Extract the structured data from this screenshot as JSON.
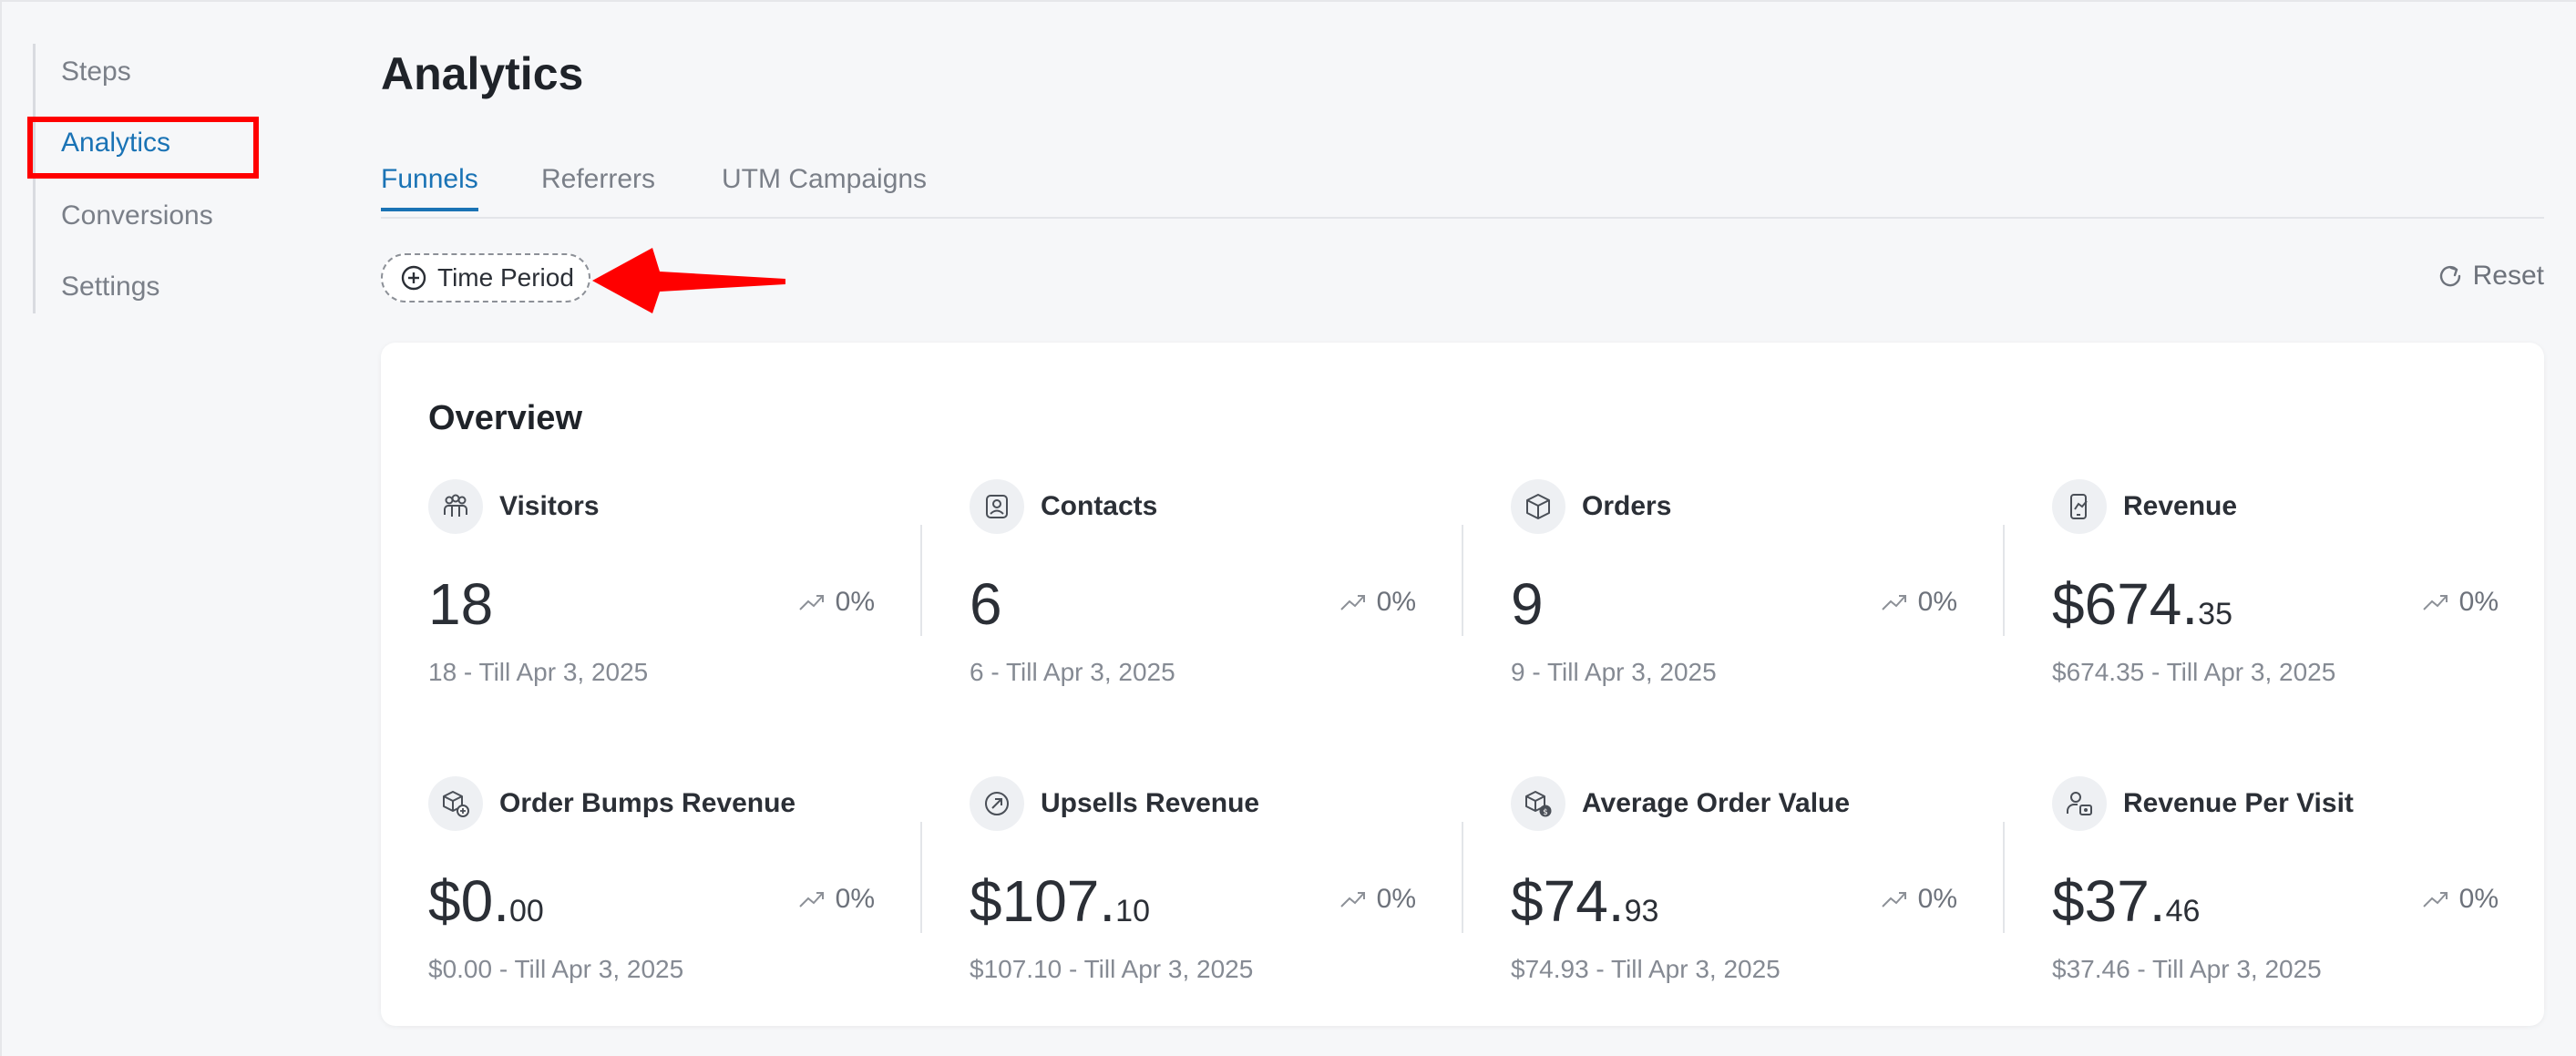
{
  "sidebar": {
    "items": [
      {
        "label": "Steps"
      },
      {
        "label": "Analytics"
      },
      {
        "label": "Conversions"
      },
      {
        "label": "Settings"
      }
    ],
    "active_index": 1
  },
  "header": {
    "title": "Analytics"
  },
  "tabs": [
    {
      "label": "Funnels"
    },
    {
      "label": "Referrers"
    },
    {
      "label": "UTM Campaigns"
    }
  ],
  "filters": {
    "time_period_label": "Time Period",
    "reset_label": "Reset"
  },
  "overview": {
    "title": "Overview",
    "metrics": [
      {
        "label": "Visitors",
        "icon": "visitors-icon",
        "value_main": "18",
        "value_cents": "",
        "change": "0%",
        "sub": "18 - Till Apr 3, 2025"
      },
      {
        "label": "Contacts",
        "icon": "contacts-icon",
        "value_main": "6",
        "value_cents": "",
        "change": "0%",
        "sub": "6 - Till Apr 3, 2025"
      },
      {
        "label": "Orders",
        "icon": "box-icon",
        "value_main": "9",
        "value_cents": "",
        "change": "0%",
        "sub": "9 - Till Apr 3, 2025"
      },
      {
        "label": "Revenue",
        "icon": "revenue-icon",
        "value_main": "$674.",
        "value_cents": "35",
        "change": "0%",
        "sub": "$674.35 - Till Apr 3, 2025"
      },
      {
        "label": "Order Bumps Revenue",
        "icon": "order-bump-icon",
        "value_main": "$0.",
        "value_cents": "00",
        "change": "0%",
        "sub": "$0.00 - Till Apr 3, 2025"
      },
      {
        "label": "Upsells Revenue",
        "icon": "upsell-icon",
        "value_main": "$107.",
        "value_cents": "10",
        "change": "0%",
        "sub": "$107.10 - Till Apr 3, 2025"
      },
      {
        "label": "Average Order Value",
        "icon": "average-order-icon",
        "value_main": "$74.",
        "value_cents": "93",
        "change": "0%",
        "sub": "$74.93 - Till Apr 3, 2025"
      },
      {
        "label": "Revenue Per Visit",
        "icon": "revenue-per-visit-icon",
        "value_main": "$37.",
        "value_cents": "46",
        "change": "0%",
        "sub": "$37.46 - Till Apr 3, 2025"
      }
    ]
  },
  "colors": {
    "accent": "#1a73b5",
    "annotation_red": "#ff0000",
    "text": "#2b2f36",
    "muted": "#858a93"
  }
}
